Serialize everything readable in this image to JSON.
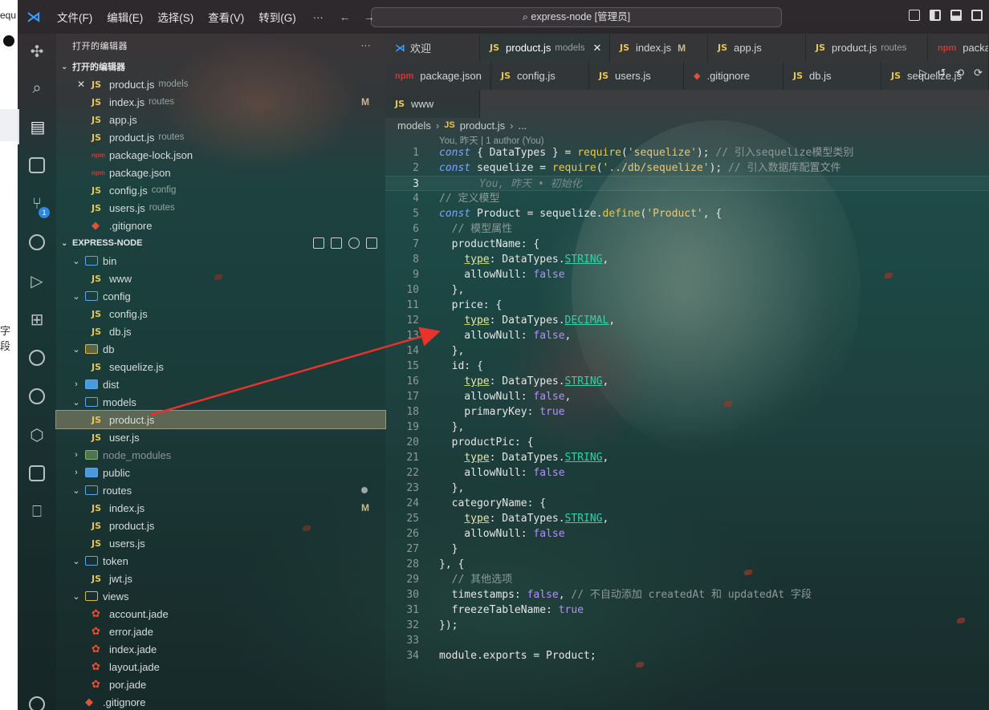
{
  "browser_strip": {
    "text_top": "equ",
    "text_mid": "字段"
  },
  "titlebar": {
    "menu": [
      "文件(F)",
      "编辑(E)",
      "选择(S)",
      "查看(V)",
      "转到(G)"
    ],
    "more": "···",
    "search": "express-node [管理员]"
  },
  "activity": {
    "source_control_badge": "1"
  },
  "sidebar": {
    "header": "打开的编辑器",
    "header_more": "···",
    "open_editors_title": "打开的编辑器",
    "open_editors": [
      {
        "icon": "JS",
        "name": "product.js",
        "desc": "models",
        "close": "✕",
        "mark": ""
      },
      {
        "icon": "JS",
        "name": "index.js",
        "desc": "routes",
        "close": "",
        "mark": "M"
      },
      {
        "icon": "JS",
        "name": "app.js",
        "desc": "",
        "close": "",
        "mark": ""
      },
      {
        "icon": "JS",
        "name": "product.js",
        "desc": "routes",
        "close": "",
        "mark": ""
      },
      {
        "icon": "npm",
        "name": "package-lock.json",
        "desc": "",
        "close": "",
        "mark": ""
      },
      {
        "icon": "npm",
        "name": "package.json",
        "desc": "",
        "close": "",
        "mark": ""
      },
      {
        "icon": "JS",
        "name": "config.js",
        "desc": "config",
        "close": "",
        "mark": ""
      },
      {
        "icon": "JS",
        "name": "users.js",
        "desc": "routes",
        "close": "",
        "mark": ""
      },
      {
        "icon": "git",
        "name": ".gitignore",
        "desc": "",
        "close": "",
        "mark": ""
      }
    ],
    "explorer_title": "EXPRESS-NODE",
    "tree": [
      {
        "type": "folder",
        "name": "bin",
        "depth": 1,
        "open": true,
        "style": "plain"
      },
      {
        "type": "file",
        "icon": "JS",
        "name": "www",
        "depth": 2
      },
      {
        "type": "folder",
        "name": "config",
        "depth": 1,
        "open": true,
        "style": "plain"
      },
      {
        "type": "file",
        "icon": "JS",
        "name": "config.js",
        "depth": 2
      },
      {
        "type": "file",
        "icon": "JS",
        "name": "db.js",
        "depth": 2
      },
      {
        "type": "folder",
        "name": "db",
        "depth": 1,
        "open": true,
        "style": "db"
      },
      {
        "type": "file",
        "icon": "JS",
        "name": "sequelize.js",
        "depth": 2
      },
      {
        "type": "folder",
        "name": "dist",
        "depth": 1,
        "open": false,
        "style": "fill"
      },
      {
        "type": "folder",
        "name": "models",
        "depth": 1,
        "open": true,
        "style": "plain"
      },
      {
        "type": "file",
        "icon": "JS",
        "name": "product.js",
        "depth": 2,
        "selected": true
      },
      {
        "type": "file",
        "icon": "JS",
        "name": "user.js",
        "depth": 2
      },
      {
        "type": "folder",
        "name": "node_modules",
        "depth": 1,
        "open": false,
        "style": "nm",
        "muted": true
      },
      {
        "type": "folder",
        "name": "public",
        "depth": 1,
        "open": false,
        "style": "fill"
      },
      {
        "type": "folder",
        "name": "routes",
        "depth": 1,
        "open": true,
        "style": "plain",
        "dot": true
      },
      {
        "type": "file",
        "icon": "JS",
        "name": "index.js",
        "depth": 2,
        "mark": "M"
      },
      {
        "type": "file",
        "icon": "JS",
        "name": "product.js",
        "depth": 2
      },
      {
        "type": "file",
        "icon": "JS",
        "name": "users.js",
        "depth": 2
      },
      {
        "type": "folder",
        "name": "token",
        "depth": 1,
        "open": true,
        "style": "plain"
      },
      {
        "type": "file",
        "icon": "JS",
        "name": "jwt.js",
        "depth": 2
      },
      {
        "type": "folder",
        "name": "views",
        "depth": 1,
        "open": true,
        "style": "views"
      },
      {
        "type": "file",
        "icon": "jade",
        "name": "account.jade",
        "depth": 2
      },
      {
        "type": "file",
        "icon": "jade",
        "name": "error.jade",
        "depth": 2
      },
      {
        "type": "file",
        "icon": "jade",
        "name": "index.jade",
        "depth": 2
      },
      {
        "type": "file",
        "icon": "jade",
        "name": "layout.jade",
        "depth": 2
      },
      {
        "type": "file",
        "icon": "jade",
        "name": "por.jade",
        "depth": 2
      },
      {
        "type": "file",
        "icon": "git",
        "name": ".gitignore",
        "depth": 1
      }
    ]
  },
  "tabs": {
    "row1": [
      {
        "icon": "vs",
        "label": "欢迎",
        "desc": "",
        "mark": "",
        "active": false
      },
      {
        "icon": "JS",
        "label": "product.js",
        "desc": "models",
        "mark": "",
        "close": "✕",
        "active": true
      },
      {
        "icon": "JS",
        "label": "index.js",
        "desc": "",
        "mark": "M",
        "active": false
      },
      {
        "icon": "JS",
        "label": "app.js",
        "desc": "",
        "mark": "",
        "active": false
      },
      {
        "icon": "JS",
        "label": "product.js",
        "desc": "routes",
        "mark": "",
        "active": false
      },
      {
        "icon": "npm",
        "label": "package",
        "desc": "",
        "mark": "",
        "active": false
      }
    ],
    "row2": [
      {
        "icon": "npm",
        "label": "package.json"
      },
      {
        "icon": "JS",
        "label": "config.js"
      },
      {
        "icon": "JS",
        "label": "users.js"
      },
      {
        "icon": "git",
        "label": ".gitignore"
      },
      {
        "icon": "JS",
        "label": "db.js"
      },
      {
        "icon": "JS",
        "label": "sequelize.js"
      }
    ],
    "row3": [
      {
        "icon": "JS",
        "label": "www"
      }
    ]
  },
  "breadcrumb": {
    "folder": "models",
    "file": "product.js",
    "rest": "..."
  },
  "codelens": "You, 昨天 | 1 author (You)",
  "code": {
    "current_line": 3,
    "blame": "You, 昨天 • 初始化",
    "lines": [
      "const { DataTypes } = require('sequelize'); // 引入sequelize模型类别",
      "const sequelize = require('../db/sequelize'); // 引入数据库配置文件",
      "",
      "// 定义模型",
      "const Product = sequelize.define('Product', {",
      "  // 模型属性",
      "  productName: {",
      "    type: DataTypes.STRING,",
      "    allowNull: false",
      "  },",
      "  price: {",
      "    type: DataTypes.DECIMAL,",
      "    allowNull: false,",
      "  },",
      "  id: {",
      "    type: DataTypes.STRING,",
      "    allowNull: false,",
      "    primaryKey: true",
      "  },",
      "  productPic: {",
      "    type: DataTypes.STRING,",
      "    allowNull: false",
      "  },",
      "  categoryName: {",
      "    type: DataTypes.STRING,",
      "    allowNull: false",
      "  }",
      "}, {",
      "  // 其他选项",
      "  timestamps: false, // 不自动添加 createdAt 和 updatedAt 字段",
      "  freezeTableName: true",
      "});",
      "",
      "module.exports = Product;"
    ]
  },
  "colors": {
    "accent": "#3aa0ff",
    "arrow": "#e8322a",
    "js": "#e8c84a"
  }
}
